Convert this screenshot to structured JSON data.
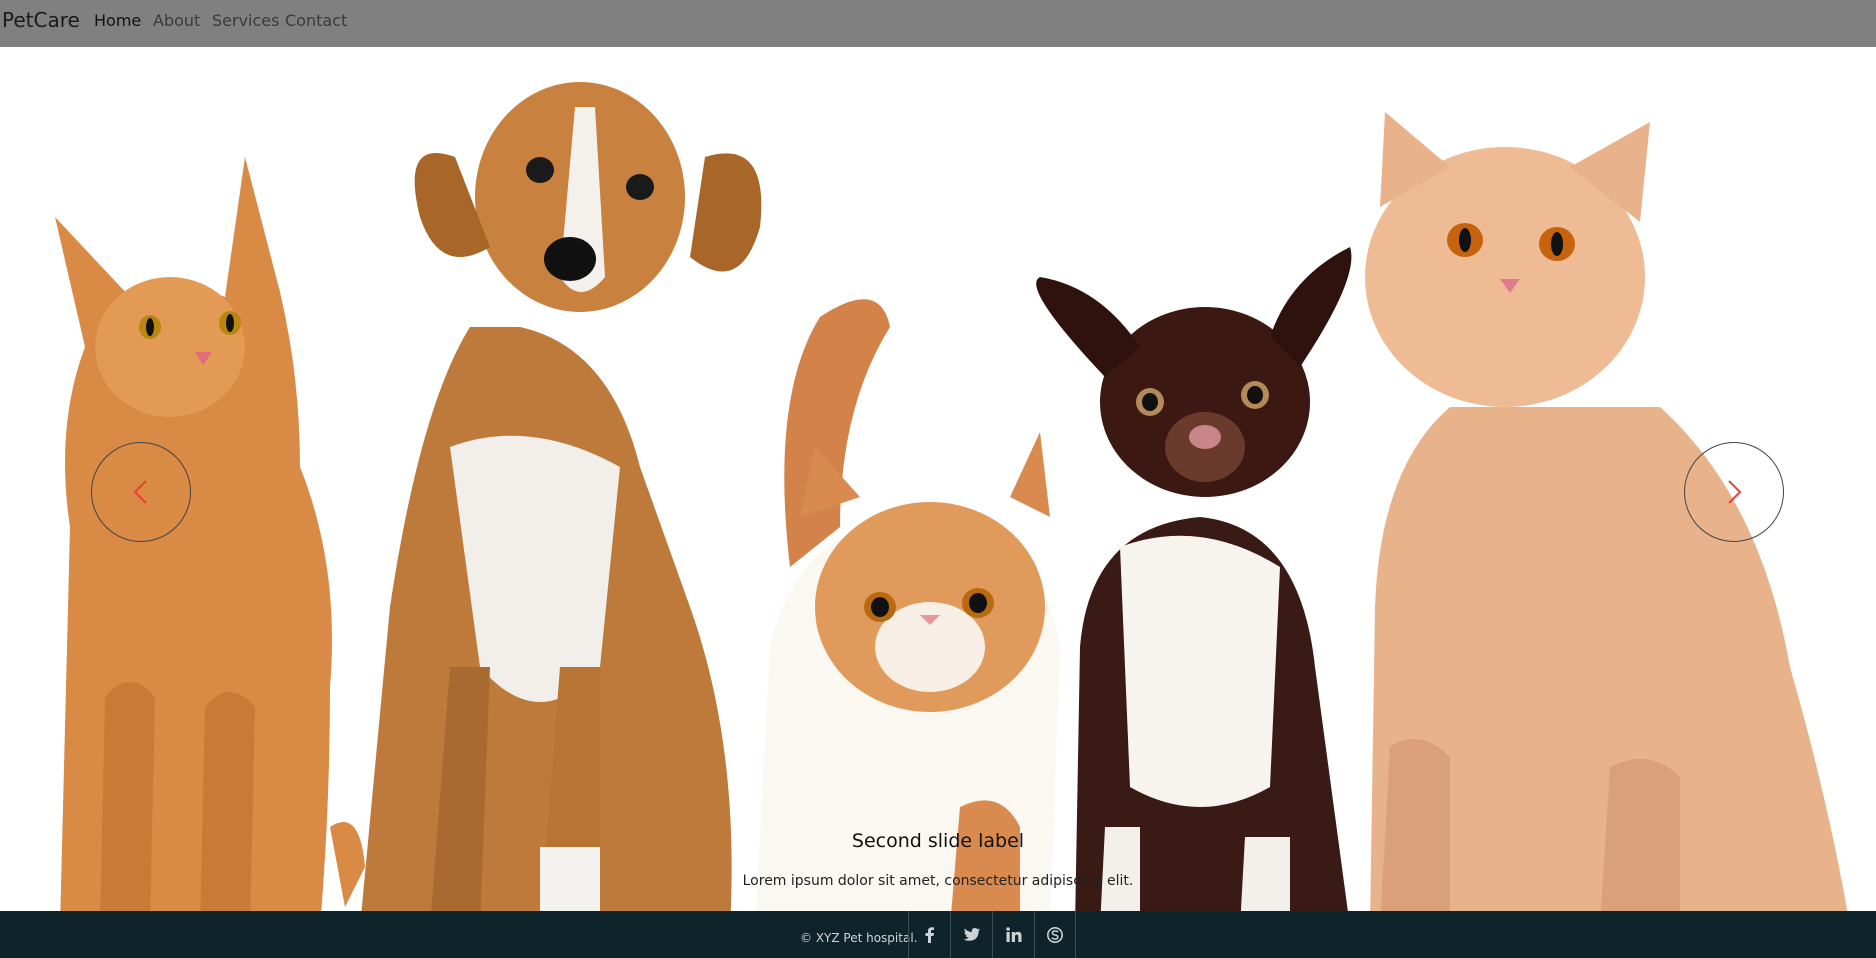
{
  "navbar": {
    "brand": "PetCare",
    "links": [
      {
        "label": "Home",
        "active": true
      },
      {
        "label": "About",
        "active": false
      },
      {
        "label": "Services",
        "active": false
      },
      {
        "label": "Contact",
        "active": false
      }
    ]
  },
  "carousel": {
    "caption_title": "Second slide label",
    "caption_text": "Lorem ipsum dolor sit amet, consectetur adipiscing elit.",
    "prev_icon": "chevron-left-icon",
    "next_icon": "chevron-right-icon",
    "control_arrow_color": "#e8423c"
  },
  "footer": {
    "copyright": "© XYZ Pet hospital.",
    "social": [
      {
        "icon": "facebook-icon"
      },
      {
        "icon": "twitter-icon"
      },
      {
        "icon": "linkedin-icon"
      },
      {
        "icon": "skype-icon"
      }
    ]
  },
  "colors": {
    "navbar_bg": "#808080",
    "footer_bg": "#0f232a"
  }
}
